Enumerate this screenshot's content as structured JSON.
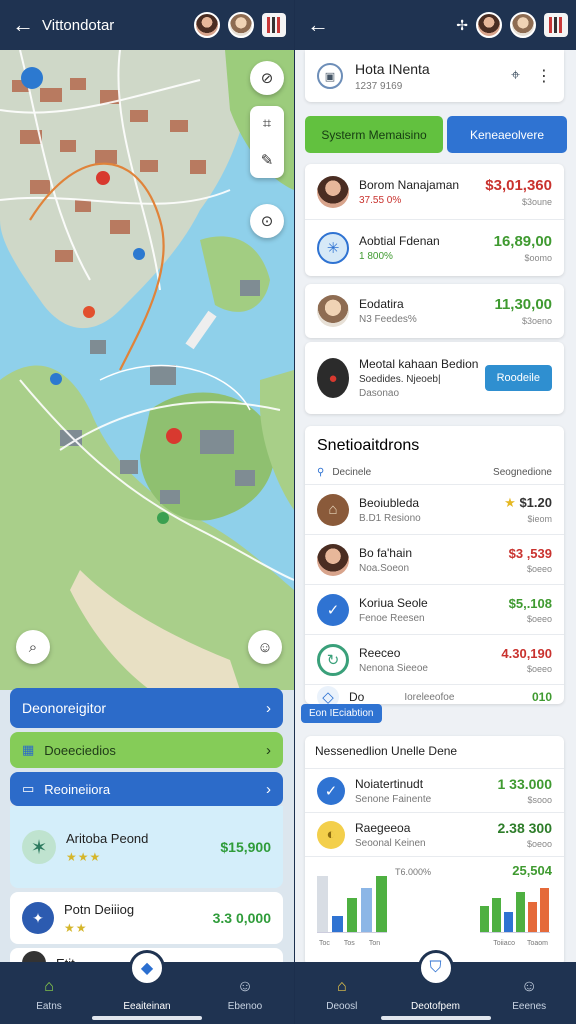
{
  "left": {
    "topbar": {
      "back": "←",
      "title": "Vittondotar"
    },
    "map": {
      "button_labels": [
        "⊘",
        "⌗",
        "✎",
        "⊙"
      ]
    },
    "list": {
      "header": "Deonoreigitor",
      "row2": "Doeeciedios",
      "row3": "Reoineiiora",
      "card1": {
        "name": "Aritoba Peond",
        "stars": "★★★",
        "price": "$15,900"
      },
      "card2": {
        "name": "Potn Deiiiog",
        "stars": "★★",
        "price": "3.3 0,000"
      },
      "card3": {
        "name": "Etit"
      }
    },
    "nav": [
      {
        "label": "Eatns"
      },
      {
        "label": "Eeaiteinan"
      },
      {
        "label": "Ebenoo"
      }
    ]
  },
  "right": {
    "topbar": {
      "back": "←",
      "spark": "✢"
    },
    "header_card": {
      "title": "Hota INenta",
      "sub": "1237 9169"
    },
    "buttons": {
      "green": "Systerm Memaisino",
      "blue": "Keneaeolvere"
    },
    "accounts": [
      {
        "t1": "Borom Nanajaman",
        "t2": "37.55 0%",
        "v1": "$3,01,360",
        "v2": "$3oune",
        "color": "red"
      },
      {
        "t1": "Aobtial Fdenan",
        "t2": "1 800%",
        "v1": "16,89,00",
        "v2": "$oomo",
        "color": "green"
      },
      {
        "t1": "Eodatira",
        "t2": "N3 Feedes%",
        "v1": "11,30,00",
        "v2": "$3oeno",
        "color": "green"
      },
      {
        "t1": "Meotal kahaan Bedion",
        "t2": "Soedides. Njeoeb|",
        "t3": "Dasonao",
        "btn": "Roodeile"
      }
    ],
    "transactions": {
      "title": "Snetioaitdrons",
      "col_left": "Decinele",
      "col_right": "Seognedione",
      "rows": [
        {
          "t1": "Beoiubleda",
          "t2": "B.D1 Resiono",
          "v1": "$1.20",
          "v2": "$ieom",
          "color": "green"
        },
        {
          "t1": "Bo fa'hain",
          "t2": "Noa.Soeon",
          "v1": "$3 ,539",
          "v2": "$oeeo",
          "color": "red"
        },
        {
          "t1": "Koriua Seole",
          "t2": "Fenoe Reesen",
          "v1": "$5,.108",
          "v2": "$oeeo",
          "color": "green"
        },
        {
          "t1": "Reeceo",
          "t2": "Nenona Sieeoe",
          "v1": "4.30,190",
          "v2": "$oeeo",
          "color": "red"
        },
        {
          "t1": "Do",
          "t2": "Ioreleeofoe",
          "v1": "010",
          "v2": "",
          "color": "green"
        }
      ],
      "tooltip": "Eon IEciabtion"
    },
    "summary": {
      "title": "Nessenedlion Unelle Dene",
      "rows": [
        {
          "t1": "Noiatertinudt",
          "t2": "Senone Fainente",
          "v1": "1 33.000",
          "v2": "$sooo",
          "color": "green"
        },
        {
          "t1": "Raegeeoa",
          "t2": "Seoonal Keinen",
          "v1": "2.38 300",
          "v2": "$oeoo",
          "color": "green"
        }
      ],
      "chart_left": {
        "label": "T6.000%",
        "ticks": [
          "Toc",
          "Tos",
          "Ton"
        ]
      },
      "chart_right": {
        "label": "25,504",
        "ticks": [
          "Toiiaco",
          "Toaom"
        ]
      }
    },
    "nav": [
      {
        "label": "Deoosl"
      },
      {
        "label": "Deotofpem"
      },
      {
        "label": "Eeenes"
      }
    ]
  },
  "colors": {
    "navy": "#1f3351",
    "green": "#5cbf3b",
    "blue": "#2f73d2",
    "red": "#c9322e"
  }
}
